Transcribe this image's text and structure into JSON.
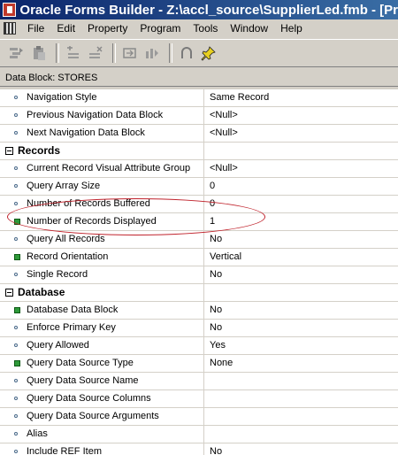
{
  "window": {
    "title": "Oracle Forms Builder - Z:\\accl_source\\SupplierLed.fmb - [Prop"
  },
  "menu": [
    "File",
    "Edit",
    "Property",
    "Program",
    "Tools",
    "Window",
    "Help"
  ],
  "toolbar": {
    "buttons": [
      "copy-properties-icon",
      "paste-properties-icon",
      "add-property-icon",
      "delete-property-icon",
      "inherit-icon",
      "property-class-icon",
      "intersection-icon",
      "pin-icon"
    ]
  },
  "block_label": "Data Block: STORES",
  "properties": [
    {
      "type": "prop",
      "marker": "bullet",
      "name": "Navigation Style",
      "value": "Same Record"
    },
    {
      "type": "prop",
      "marker": "bullet",
      "name": "Previous Navigation Data Block",
      "value": "<Null>"
    },
    {
      "type": "prop",
      "marker": "bullet",
      "name": "Next Navigation Data Block",
      "value": "<Null>"
    },
    {
      "type": "cat",
      "name": "Records"
    },
    {
      "type": "prop",
      "marker": "bullet",
      "name": "Current Record Visual Attribute Group",
      "value": "<Null>"
    },
    {
      "type": "prop",
      "marker": "bullet",
      "name": "Query Array Size",
      "value": "0"
    },
    {
      "type": "prop",
      "marker": "bullet",
      "name": "Number of Records Buffered",
      "value": "0"
    },
    {
      "type": "prop",
      "marker": "square",
      "name": "Number of Records Displayed",
      "value": "1"
    },
    {
      "type": "prop",
      "marker": "bullet",
      "name": "Query All Records",
      "value": "No"
    },
    {
      "type": "prop",
      "marker": "square",
      "name": "Record Orientation",
      "value": "Vertical"
    },
    {
      "type": "prop",
      "marker": "bullet",
      "name": "Single Record",
      "value": "No"
    },
    {
      "type": "cat",
      "name": "Database"
    },
    {
      "type": "prop",
      "marker": "square",
      "name": "Database Data Block",
      "value": "No"
    },
    {
      "type": "prop",
      "marker": "bullet",
      "name": "Enforce Primary Key",
      "value": "No"
    },
    {
      "type": "prop",
      "marker": "bullet",
      "name": "Query Allowed",
      "value": "Yes"
    },
    {
      "type": "prop",
      "marker": "square",
      "name": "Query Data Source Type",
      "value": "None"
    },
    {
      "type": "prop",
      "marker": "bullet",
      "name": "Query Data Source Name",
      "value": ""
    },
    {
      "type": "prop",
      "marker": "bullet",
      "name": "Query Data Source Columns",
      "value": ""
    },
    {
      "type": "prop",
      "marker": "bullet",
      "name": "Query Data Source Arguments",
      "value": ""
    },
    {
      "type": "prop",
      "marker": "bullet",
      "name": "Alias",
      "value": ""
    },
    {
      "type": "prop",
      "marker": "bullet",
      "name": "Include REF Item",
      "value": "No"
    }
  ],
  "colors": {
    "title_bar": "#0a246a",
    "annotation": "#c0232c",
    "modified_marker": "#2f9a3a"
  }
}
